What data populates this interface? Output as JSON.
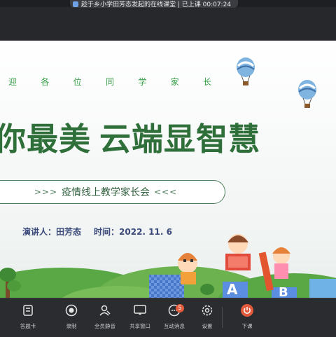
{
  "window": {
    "title": "趁于乡小学田芳态发起的在线课堂 | 已上课 00:07:24"
  },
  "slide": {
    "welcome_chars": [
      "迎",
      "各",
      "位",
      "同",
      "学",
      "家",
      "长"
    ],
    "headline_left": "你最美",
    "headline_right": "云端显智慧",
    "subtitle_left_chevrons": ">>>",
    "subtitle_text": "疫情线上教学家长会",
    "subtitle_right_chevrons": "<<<",
    "speaker": "演讲人：田芳态",
    "time": "时间：2022. 11. 6",
    "block_letters": [
      "A",
      "B"
    ]
  },
  "toolbar": {
    "items": [
      {
        "label": "答题卡",
        "icon": "answer-card-icon"
      },
      {
        "label": "录制",
        "icon": "record-icon"
      },
      {
        "label": "全员静音",
        "icon": "mute-all-icon"
      },
      {
        "label": "共享窗口",
        "icon": "share-window-icon"
      },
      {
        "label": "互动消息",
        "icon": "chat-icon",
        "badge": "5"
      },
      {
        "label": "设置",
        "icon": "settings-icon"
      },
      {
        "label": "下课",
        "icon": "power-icon"
      }
    ]
  },
  "colors": {
    "accent_green": "#2f6f3a",
    "danger_red": "#e25b3c",
    "toolbar_bg": "#2a2c30"
  }
}
